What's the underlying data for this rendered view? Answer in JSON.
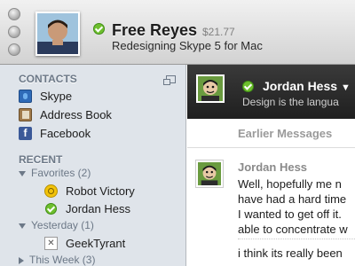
{
  "header": {
    "name": "Free Reyes",
    "credit": "$21.77",
    "mood": "Redesigning Skype 5 for Mac",
    "status_color": "#6ebf2e"
  },
  "sidebar": {
    "contacts_title": "CONTACTS",
    "contacts": [
      {
        "label": "Skype",
        "icon": "skype-icon"
      },
      {
        "label": "Address Book",
        "icon": "address-book-icon"
      },
      {
        "label": "Facebook",
        "icon": "facebook-icon"
      }
    ],
    "recent_title": "RECENT",
    "groups": [
      {
        "label": "Favorites (2)",
        "expanded": true,
        "items": [
          {
            "label": "Robot Victory",
            "icon": "group-chat-icon"
          },
          {
            "label": "Jordan Hess",
            "icon": "online-status-icon"
          }
        ]
      },
      {
        "label": "Yesterday (1)",
        "expanded": true,
        "items": [
          {
            "label": "GeekTyrant",
            "icon": "offline-contact-icon"
          }
        ]
      },
      {
        "label": "This Week (3)",
        "expanded": false,
        "items": []
      }
    ]
  },
  "conversation": {
    "peer_name": "Jordan Hess",
    "peer_mood": "Design is the langua",
    "earlier_label": "Earlier Messages",
    "message": {
      "sender": "Jordan Hess",
      "lines": [
        "Well, hopefully me n",
        "have had a hard time",
        "I wanted to get off it.",
        "able to concentrate w"
      ],
      "next_line": "i think its really been"
    }
  }
}
